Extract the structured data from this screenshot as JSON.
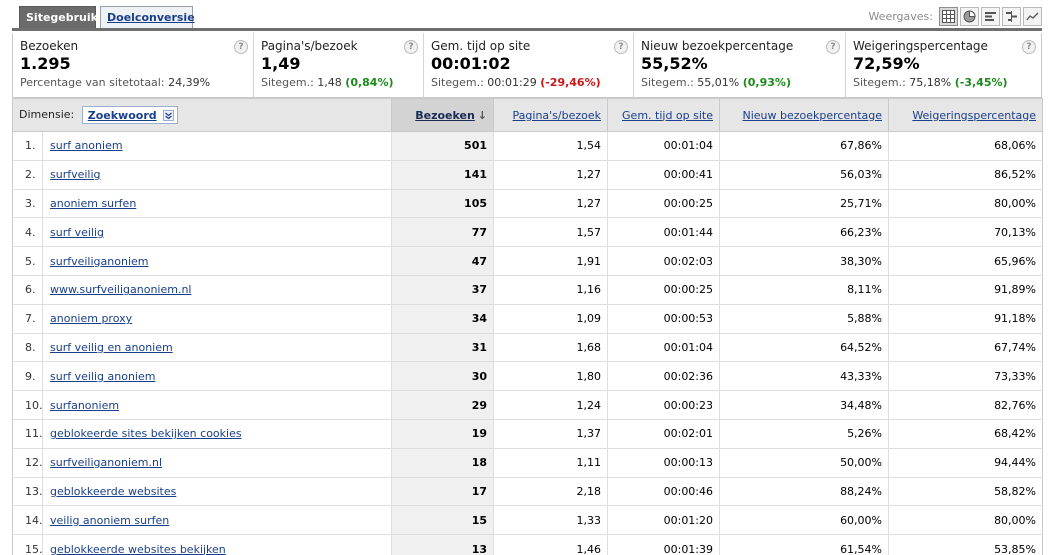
{
  "tabs": {
    "active": "Sitegebruik",
    "inactive": "Doelconversie",
    "views_label": "Weergaves:"
  },
  "metrics": [
    {
      "title": "Bezoeken",
      "value": "1.295",
      "sub_label": "Percentage van sitetotaal:",
      "sub_value": "24,39%",
      "delta": "",
      "delta_type": ""
    },
    {
      "title": "Pagina's/bezoek",
      "value": "1,49",
      "sub_label": "Sitegem.:",
      "sub_value": "1,48",
      "delta": "(0,84%)",
      "delta_type": "pos"
    },
    {
      "title": "Gem. tijd op site",
      "value": "00:01:02",
      "sub_label": "Sitegem.:",
      "sub_value": "00:01:29",
      "delta": "(-29,46%)",
      "delta_type": "neg"
    },
    {
      "title": "Nieuw bezoekpercentage",
      "value": "55,52%",
      "sub_label": "Sitegem.:",
      "sub_value": "55,01%",
      "delta": "(0,93%)",
      "delta_type": "pos"
    },
    {
      "title": "Weigeringspercentage",
      "value": "72,59%",
      "sub_label": "Sitegem.:",
      "sub_value": "75,18%",
      "delta": "(-3,45%)",
      "delta_type": "pos"
    }
  ],
  "table": {
    "dimension_label": "Dimensie:",
    "dimension_value": "Zoekwoord",
    "headers": [
      "Bezoeken",
      "Pagina's/bezoek",
      "Gem. tijd op site",
      "Nieuw bezoekpercentage",
      "Weigeringspercentage"
    ],
    "rows": [
      [
        "1.",
        "surf anoniem",
        "501",
        "1,54",
        "00:01:04",
        "67,86%",
        "68,06%"
      ],
      [
        "2.",
        "surfveilig",
        "141",
        "1,27",
        "00:00:41",
        "56,03%",
        "86,52%"
      ],
      [
        "3.",
        "anoniem surfen",
        "105",
        "1,27",
        "00:00:25",
        "25,71%",
        "80,00%"
      ],
      [
        "4.",
        "surf veilig",
        "77",
        "1,57",
        "00:01:44",
        "66,23%",
        "70,13%"
      ],
      [
        "5.",
        "surfveiliganoniem",
        "47",
        "1,91",
        "00:02:03",
        "38,30%",
        "65,96%"
      ],
      [
        "6.",
        "www.surfveiliganoniem.nl",
        "37",
        "1,16",
        "00:00:25",
        "8,11%",
        "91,89%"
      ],
      [
        "7.",
        "anoniem proxy",
        "34",
        "1,09",
        "00:00:53",
        "5,88%",
        "91,18%"
      ],
      [
        "8.",
        "surf veilig en anoniem",
        "31",
        "1,68",
        "00:01:04",
        "64,52%",
        "67,74%"
      ],
      [
        "9.",
        "surf veilig anoniem",
        "30",
        "1,80",
        "00:02:36",
        "43,33%",
        "73,33%"
      ],
      [
        "10.",
        "surfanoniem",
        "29",
        "1,24",
        "00:00:23",
        "34,48%",
        "82,76%"
      ],
      [
        "11.",
        "geblokeerde sites bekijken cookies",
        "19",
        "1,37",
        "00:02:01",
        "5,26%",
        "68,42%"
      ],
      [
        "12.",
        "surfveiliganoniem.nl",
        "18",
        "1,11",
        "00:00:13",
        "50,00%",
        "94,44%"
      ],
      [
        "13.",
        "geblokkeerde websites",
        "17",
        "2,18",
        "00:00:46",
        "88,24%",
        "58,82%"
      ],
      [
        "14.",
        "veilig anoniem surfen",
        "15",
        "1,33",
        "00:01:20",
        "60,00%",
        "80,00%"
      ],
      [
        "15.",
        "geblokkeerde websites bekijken",
        "13",
        "1,46",
        "00:01:39",
        "61,54%",
        "53,85%"
      ]
    ]
  },
  "icons": {
    "help": "?",
    "sort_arrow": "↓",
    "dropdown": "chevron-down-icon"
  },
  "colors": {
    "positive": "#1b8a1b",
    "negative": "#c81818",
    "link": "#1a3f8a"
  }
}
